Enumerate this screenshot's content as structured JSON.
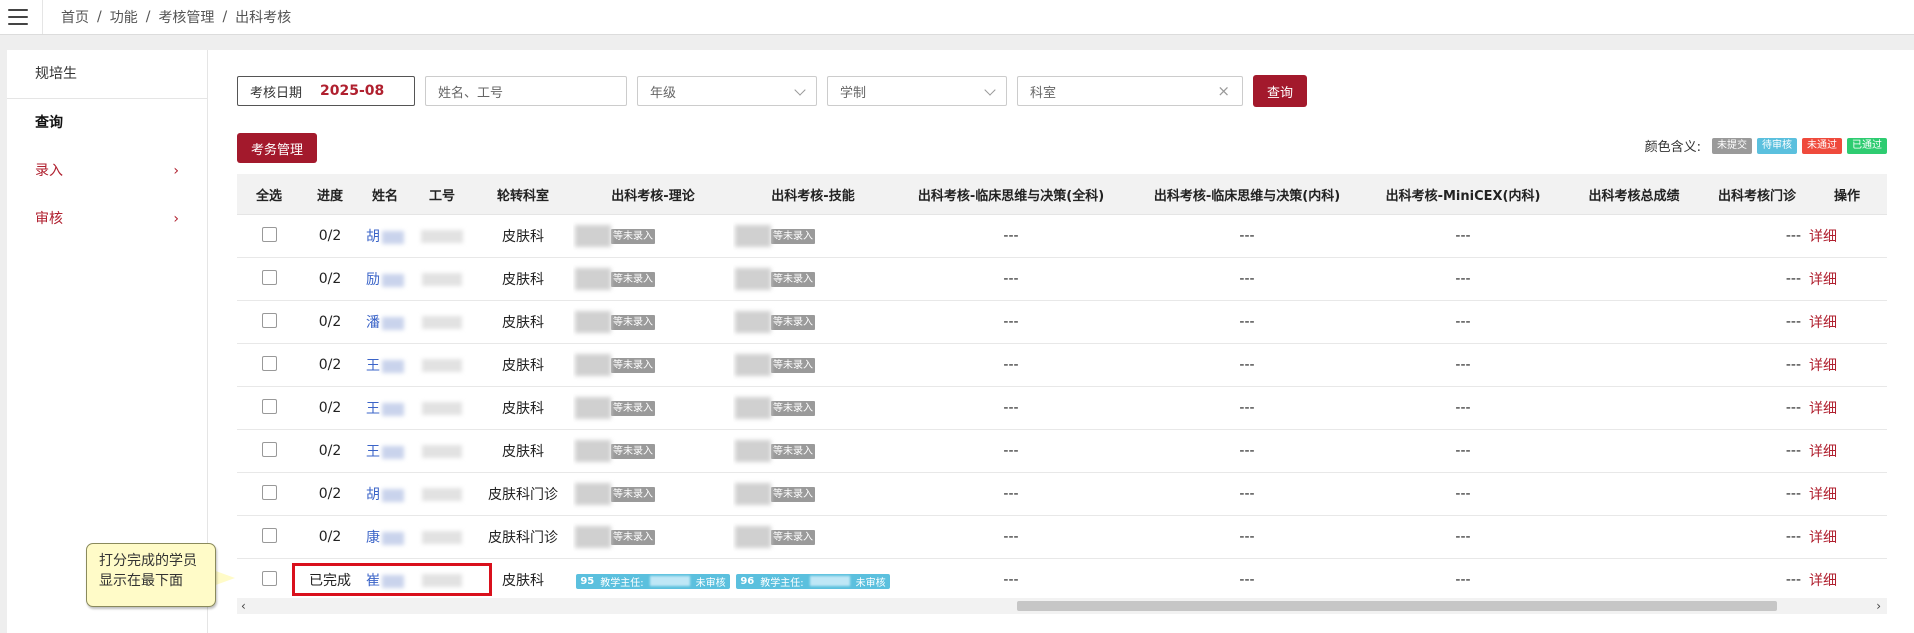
{
  "breadcrumb": [
    "首页",
    "功能",
    "考核管理",
    "出科考核"
  ],
  "sidebar": {
    "header": "规培生",
    "items": [
      {
        "label": "查询",
        "arrow": false
      },
      {
        "label": "录入",
        "arrow": true
      },
      {
        "label": "审核",
        "arrow": true
      }
    ],
    "arrow_glyph": "›"
  },
  "filters": {
    "date_label": "考核日期",
    "date_value": "2025-08",
    "name_placeholder": "姓名、工号",
    "grade_placeholder": "年级",
    "system_placeholder": "学制",
    "dept_value": "科室",
    "clear_glyph": "×",
    "query_label": "查询"
  },
  "exam_admin_label": "考务管理",
  "legend": {
    "title": "颜色含义:",
    "items": [
      {
        "label": "未提交",
        "color": "#9a9a9a"
      },
      {
        "label": "待审核",
        "color": "#5bc0de"
      },
      {
        "label": "未通过",
        "color": "#ef4a3c"
      },
      {
        "label": "已通过",
        "color": "#2ecc71"
      }
    ]
  },
  "table": {
    "headers": [
      "全选",
      "进度",
      "姓名",
      "工号",
      "轮转科室",
      "出科考核-理论",
      "出科考核-技能",
      "出科考核-临床思维与决策(全科)",
      "出科考核-临床思维与决策(内科)",
      "出科考核-MiniCEX(内科)",
      "出科考核总成绩",
      "出科考核门诊",
      "操作"
    ],
    "rows": [
      {
        "progress": "0/2",
        "name": "胡",
        "dept": "皮肤科",
        "theory": "等未录入",
        "skill": "等未录入",
        "c1": "---",
        "c2": "---",
        "c3": "---",
        "c4": "---",
        "action": "详细"
      },
      {
        "progress": "0/2",
        "name": "励",
        "dept": "皮肤科",
        "theory": "等未录入",
        "skill": "等未录入",
        "c1": "---",
        "c2": "---",
        "c3": "---",
        "c4": "---",
        "action": "详细"
      },
      {
        "progress": "0/2",
        "name": "潘",
        "dept": "皮肤科",
        "theory": "等未录入",
        "skill": "等未录入",
        "c1": "---",
        "c2": "---",
        "c3": "---",
        "c4": "---",
        "action": "详细"
      },
      {
        "progress": "0/2",
        "name": "王",
        "dept": "皮肤科",
        "theory": "等未录入",
        "skill": "等未录入",
        "c1": "---",
        "c2": "---",
        "c3": "---",
        "c4": "---",
        "action": "详细"
      },
      {
        "progress": "0/2",
        "name": "王",
        "dept": "皮肤科",
        "theory": "等未录入",
        "skill": "等未录入",
        "c1": "---",
        "c2": "---",
        "c3": "---",
        "c4": "---",
        "action": "详细"
      },
      {
        "progress": "0/2",
        "name": "王",
        "dept": "皮肤科",
        "theory": "等未录入",
        "skill": "等未录入",
        "c1": "---",
        "c2": "---",
        "c3": "---",
        "c4": "---",
        "action": "详细"
      },
      {
        "progress": "0/2",
        "name": "胡",
        "dept": "皮肤科门诊",
        "theory": "等未录入",
        "skill": "等未录入",
        "c1": "---",
        "c2": "---",
        "c3": "---",
        "c4": "---",
        "action": "详细"
      },
      {
        "progress": "0/2",
        "name": "康",
        "dept": "皮肤科门诊",
        "theory": "等未录入",
        "skill": "等未录入",
        "c1": "---",
        "c2": "---",
        "c3": "---",
        "c4": "---",
        "action": "详细"
      }
    ],
    "last_row": {
      "progress": "已完成",
      "name": "崔",
      "dept": "皮肤科",
      "theory_score": "95",
      "skill_score": "96",
      "reviewer_label": "教学主任:",
      "status": "未审核",
      "c1": "---",
      "c2": "---",
      "c3": "---",
      "c4": "---",
      "action": "详细"
    }
  },
  "scroll_arrows": {
    "left": "‹",
    "right": "›"
  },
  "callout": {
    "line1": "打分完成的学员",
    "line2": "显示在最下面"
  },
  "accent_color": "#a3192c"
}
